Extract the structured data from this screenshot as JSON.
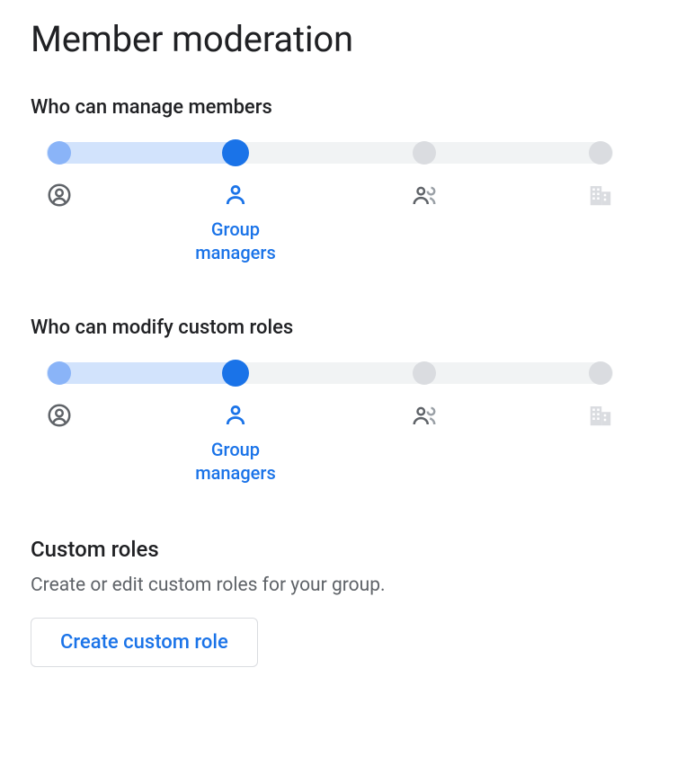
{
  "page_title": "Member moderation",
  "sliders": [
    {
      "label": "Who can manage members",
      "selected_index": 1,
      "options": [
        {
          "icon": "owner-icon"
        },
        {
          "icon": "person-icon",
          "label": "Group managers"
        },
        {
          "icon": "people-icon"
        },
        {
          "icon": "org-icon"
        }
      ]
    },
    {
      "label": "Who can modify custom roles",
      "selected_index": 1,
      "options": [
        {
          "icon": "owner-icon"
        },
        {
          "icon": "person-icon",
          "label": "Group managers"
        },
        {
          "icon": "people-icon"
        },
        {
          "icon": "org-icon"
        }
      ]
    }
  ],
  "custom_roles": {
    "heading": "Custom roles",
    "description": "Create or edit custom roles for your group.",
    "button_label": "Create custom role"
  },
  "colors": {
    "primary": "#1a73e8",
    "filled_track": "#d2e3fc",
    "track_bg": "#f1f3f4",
    "inactive_dot": "#dadce0",
    "secondary_text": "#5f6368"
  }
}
